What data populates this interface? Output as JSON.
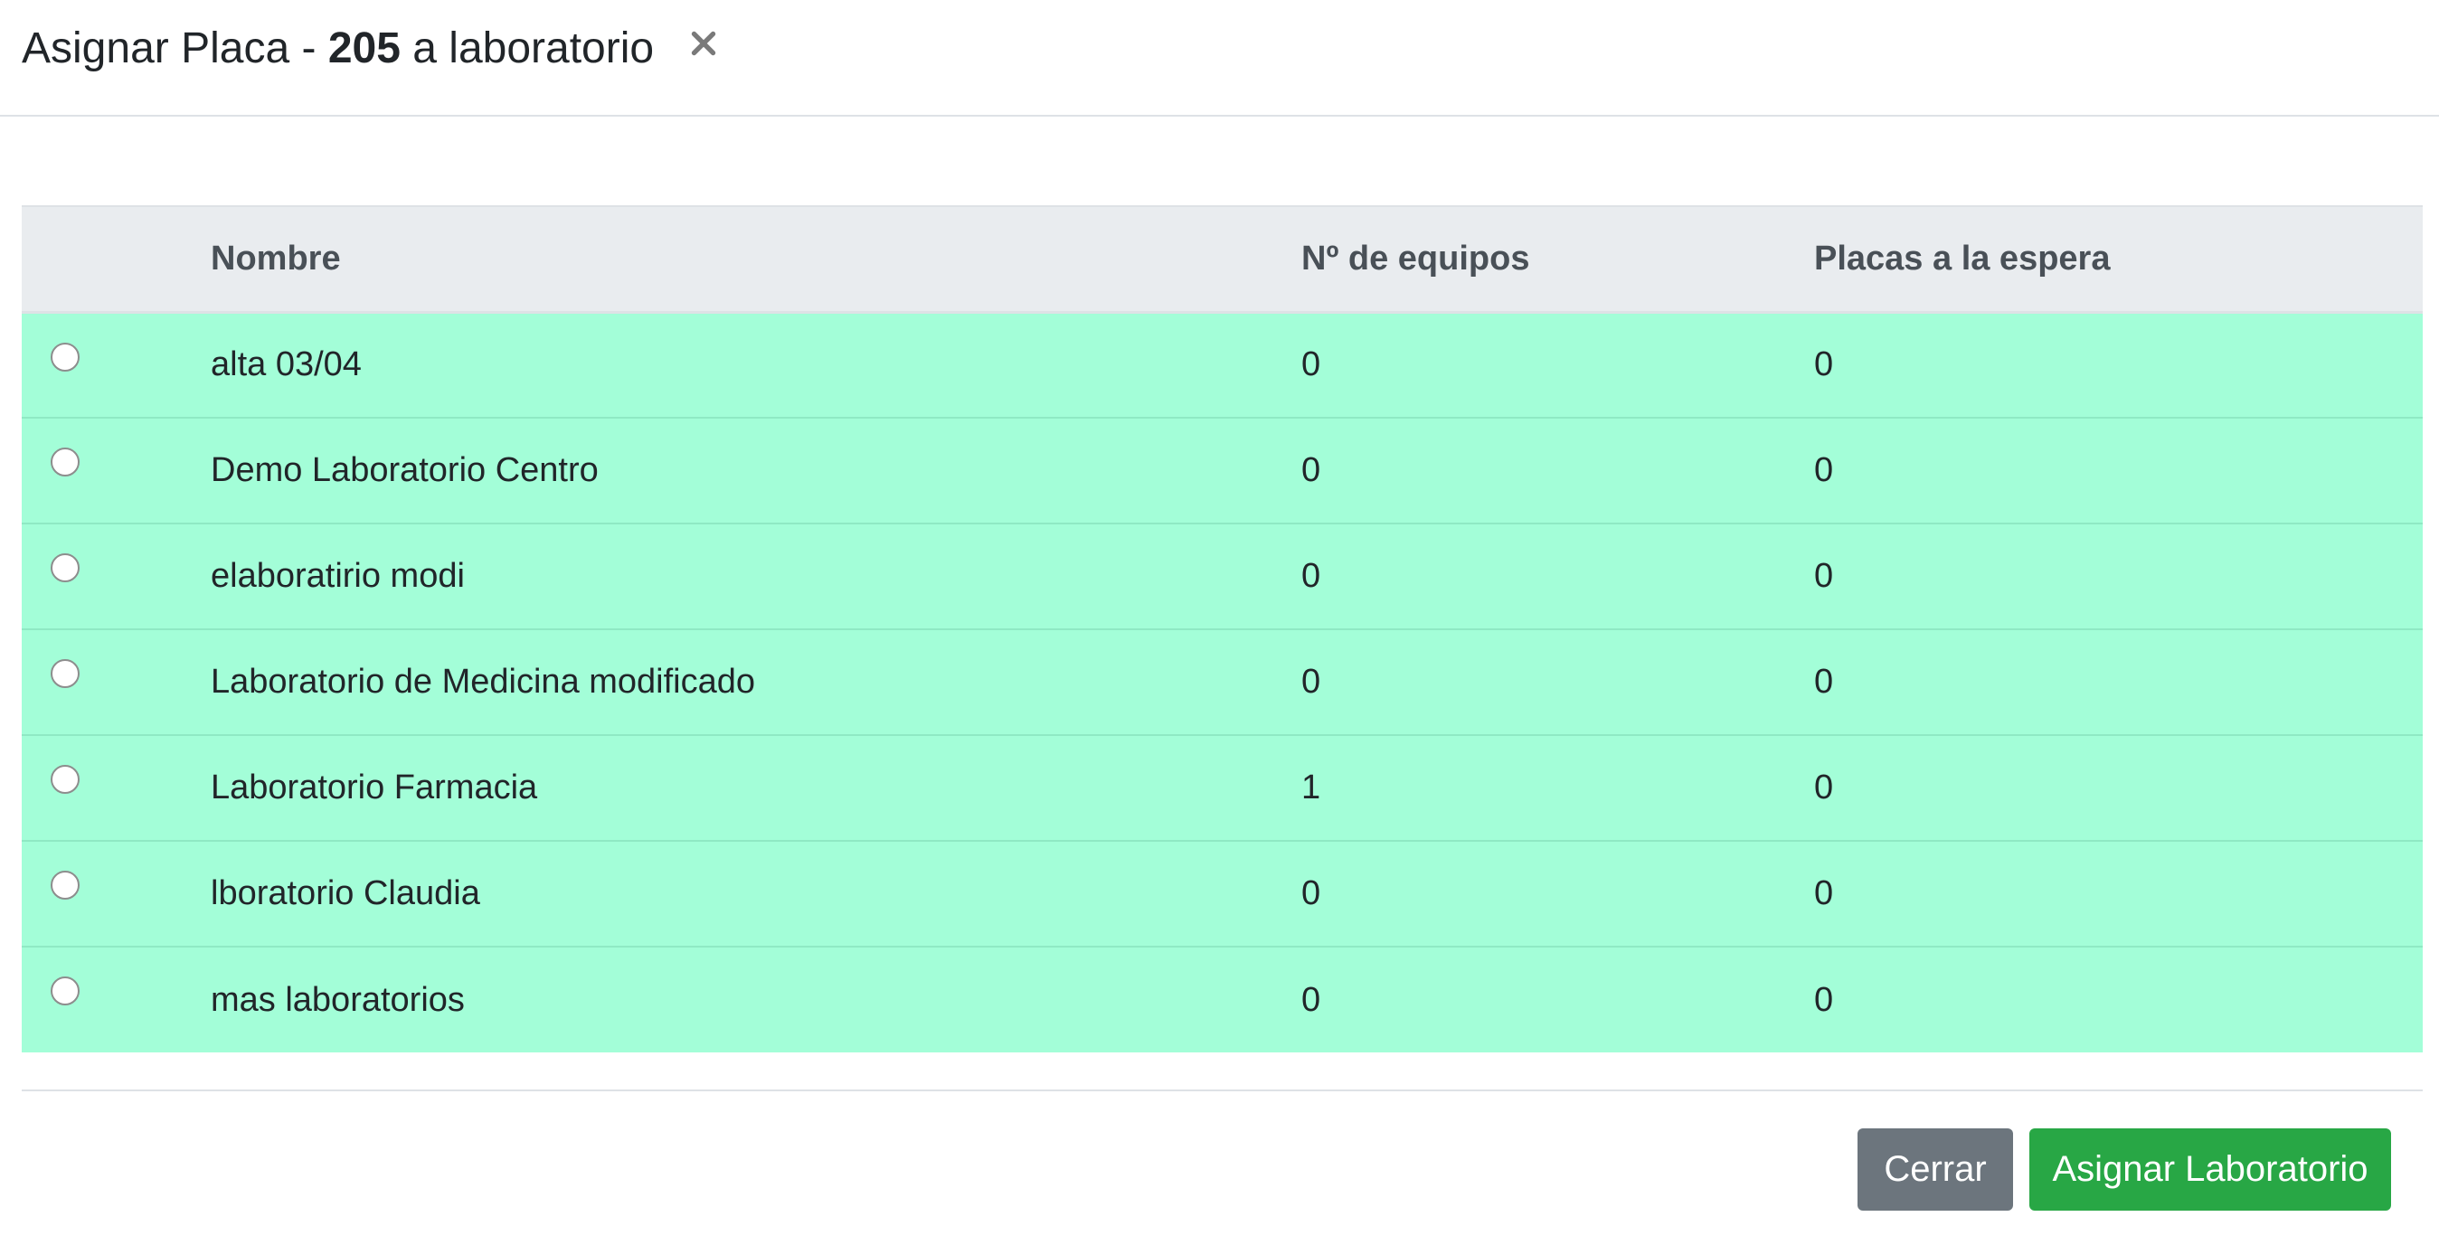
{
  "header": {
    "title_prefix": "Asignar Placa - ",
    "plate_number": "205",
    "title_suffix": " a laboratorio",
    "close_icon": "close-icon"
  },
  "table": {
    "columns": [
      "",
      "Nombre",
      "Nº de equipos",
      "Placas a la espera"
    ],
    "rows": [
      {
        "name": "alta 03/04",
        "equipos": "0",
        "placas": "0",
        "selected": false
      },
      {
        "name": "Demo Laboratorio Centro",
        "equipos": "0",
        "placas": "0",
        "selected": false
      },
      {
        "name": "elaboratirio modi",
        "equipos": "0",
        "placas": "0",
        "selected": false
      },
      {
        "name": "Laboratorio de Medicina modificado",
        "equipos": "0",
        "placas": "0",
        "selected": false
      },
      {
        "name": "Laboratorio Farmacia",
        "equipos": "1",
        "placas": "0",
        "selected": false
      },
      {
        "name": "lboratorio Claudia",
        "equipos": "0",
        "placas": "0",
        "selected": false
      },
      {
        "name": "mas laboratorios",
        "equipos": "0",
        "placas": "0",
        "selected": false
      }
    ],
    "row_color": "#a3fed8",
    "header_color": "#e9ecef"
  },
  "footer": {
    "close_label": "Cerrar",
    "assign_label": "Asignar Laboratorio",
    "close_color": "#6c757d",
    "assign_color": "#28a745"
  }
}
